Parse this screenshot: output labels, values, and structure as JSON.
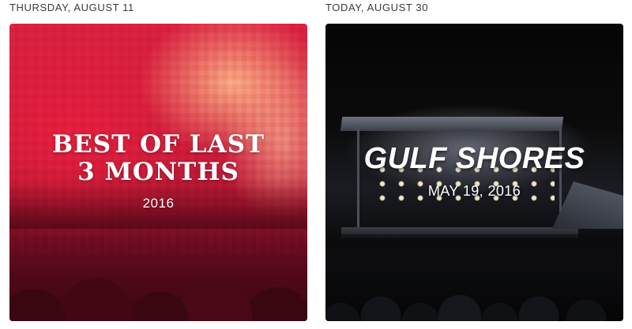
{
  "memories": [
    {
      "header": "THURSDAY, AUGUST 11",
      "title_line1": "BEST OF LAST",
      "title_line2": "3 MONTHS",
      "subtitle": "2016"
    },
    {
      "header": "TODAY, AUGUST 30",
      "title": "GULF SHORES",
      "subtitle": "MAY 19, 2016"
    }
  ]
}
